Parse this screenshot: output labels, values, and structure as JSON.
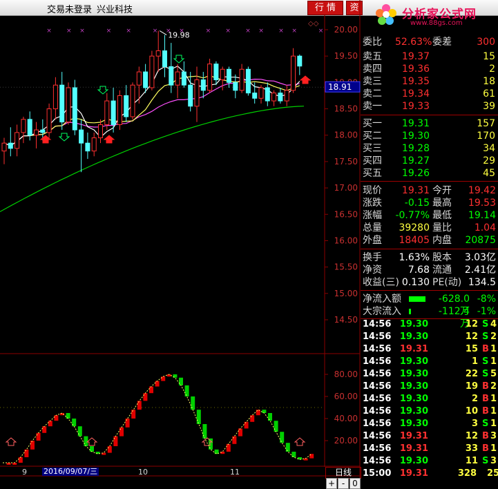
{
  "topbar": {
    "login_status": "交易未登录",
    "stock_name": "兴业科技",
    "btn_quote": "行 情",
    "btn_trade": "资"
  },
  "logo": {
    "title": "分析家公式网",
    "url": "www.88gs.com"
  },
  "chart": {
    "price_axis": [
      "20.00",
      "19.50",
      "19.00",
      "18.50",
      "18.00",
      "17.50",
      "17.00",
      "16.50",
      "16.00",
      "15.50",
      "15.00",
      "14.50"
    ],
    "current_price_tag": "18.91",
    "high_label": "19.98",
    "indicator_axis": [
      "80.00",
      "60.00",
      "40.00",
      "20.00"
    ],
    "date_ticks": [
      "9",
      "10",
      "11"
    ],
    "selected_date": "2016/09/07/三",
    "period": "日线",
    "colors": {
      "up": "#ff3030",
      "down": "#54ffff",
      "ma5": "#ffffff",
      "ma10": "#ffff60",
      "ma20": "#ff50ff",
      "ma60": "#00d000",
      "grid": "#8b0000"
    }
  },
  "chart_data": {
    "type": "line",
    "title": "",
    "price_ylim": [
      14.5,
      20.0
    ],
    "candles": [
      {
        "o": 17.7,
        "h": 17.95,
        "l": 17.45,
        "c": 17.85
      },
      {
        "o": 17.85,
        "h": 18.15,
        "l": 17.6,
        "c": 17.75
      },
      {
        "o": 17.75,
        "h": 18.2,
        "l": 17.6,
        "c": 18.05
      },
      {
        "o": 18.05,
        "h": 18.35,
        "l": 17.85,
        "c": 18.3
      },
      {
        "o": 18.3,
        "h": 18.45,
        "l": 17.9,
        "c": 18.0
      },
      {
        "o": 18.0,
        "h": 18.25,
        "l": 17.75,
        "c": 18.1
      },
      {
        "o": 18.1,
        "h": 18.3,
        "l": 17.9,
        "c": 18.05
      },
      {
        "o": 18.05,
        "h": 18.6,
        "l": 17.95,
        "c": 18.5
      },
      {
        "o": 18.5,
        "h": 19.1,
        "l": 18.3,
        "c": 18.95
      },
      {
        "o": 18.95,
        "h": 19.2,
        "l": 18.1,
        "c": 18.25
      },
      {
        "o": 18.25,
        "h": 19.0,
        "l": 18.2,
        "c": 18.9
      },
      {
        "o": 18.9,
        "h": 19.05,
        "l": 18.0,
        "c": 18.1
      },
      {
        "o": 18.1,
        "h": 18.3,
        "l": 17.3,
        "c": 17.85
      },
      {
        "o": 17.85,
        "h": 18.05,
        "l": 17.55,
        "c": 17.7
      },
      {
        "o": 17.7,
        "h": 18.05,
        "l": 17.6,
        "c": 17.95
      },
      {
        "o": 17.95,
        "h": 18.3,
        "l": 17.85,
        "c": 18.2
      },
      {
        "o": 18.2,
        "h": 18.8,
        "l": 18.1,
        "c": 18.65
      },
      {
        "o": 18.65,
        "h": 18.9,
        "l": 18.05,
        "c": 18.2
      },
      {
        "o": 18.2,
        "h": 18.85,
        "l": 18.1,
        "c": 18.75
      },
      {
        "o": 18.75,
        "h": 18.95,
        "l": 18.25,
        "c": 18.35
      },
      {
        "o": 18.35,
        "h": 19.0,
        "l": 18.3,
        "c": 18.95
      },
      {
        "o": 18.95,
        "h": 19.3,
        "l": 18.6,
        "c": 19.2
      },
      {
        "o": 19.2,
        "h": 19.35,
        "l": 18.8,
        "c": 18.9
      },
      {
        "o": 18.9,
        "h": 19.6,
        "l": 18.85,
        "c": 19.5
      },
      {
        "o": 19.5,
        "h": 19.98,
        "l": 19.2,
        "c": 19.6
      },
      {
        "o": 19.6,
        "h": 19.9,
        "l": 19.1,
        "c": 19.3
      },
      {
        "o": 19.3,
        "h": 19.75,
        "l": 18.8,
        "c": 18.95
      },
      {
        "o": 18.95,
        "h": 19.35,
        "l": 18.7,
        "c": 19.2
      },
      {
        "o": 19.2,
        "h": 19.4,
        "l": 18.9,
        "c": 18.95
      },
      {
        "o": 18.95,
        "h": 19.2,
        "l": 18.45,
        "c": 18.55
      },
      {
        "o": 18.55,
        "h": 19.3,
        "l": 18.25,
        "c": 19.05
      },
      {
        "o": 19.05,
        "h": 19.2,
        "l": 18.7,
        "c": 18.85
      },
      {
        "o": 18.85,
        "h": 19.45,
        "l": 18.8,
        "c": 19.35
      },
      {
        "o": 19.35,
        "h": 19.4,
        "l": 18.95,
        "c": 19.05
      },
      {
        "o": 19.05,
        "h": 19.3,
        "l": 18.85,
        "c": 19.25
      },
      {
        "o": 19.25,
        "h": 19.3,
        "l": 18.9,
        "c": 19.0
      },
      {
        "o": 19.0,
        "h": 19.15,
        "l": 18.7,
        "c": 18.85
      },
      {
        "o": 18.85,
        "h": 19.35,
        "l": 18.8,
        "c": 19.25
      },
      {
        "o": 19.25,
        "h": 19.3,
        "l": 18.75,
        "c": 18.8
      },
      {
        "o": 18.8,
        "h": 19.0,
        "l": 18.6,
        "c": 18.7
      },
      {
        "o": 18.7,
        "h": 18.95,
        "l": 18.6,
        "c": 18.9
      },
      {
        "o": 18.9,
        "h": 19.0,
        "l": 18.55,
        "c": 18.65
      },
      {
        "o": 18.65,
        "h": 18.85,
        "l": 18.55,
        "c": 18.8
      },
      {
        "o": 18.8,
        "h": 18.9,
        "l": 18.6,
        "c": 18.65
      },
      {
        "o": 18.65,
        "h": 18.95,
        "l": 18.55,
        "c": 18.85
      },
      {
        "o": 18.85,
        "h": 19.65,
        "l": 18.8,
        "c": 19.5
      },
      {
        "o": 19.5,
        "h": 19.53,
        "l": 19.14,
        "c": 19.31
      }
    ],
    "ma60_start_end": [
      16.55,
      18.55
    ],
    "indicator_ylim": [
      0,
      100
    ],
    "indicator": [
      0,
      0,
      0,
      5,
      12,
      20,
      27,
      33,
      38,
      43,
      45,
      40,
      33,
      24,
      15,
      10,
      8,
      9,
      15,
      24,
      32,
      40,
      48,
      56,
      63,
      69,
      74,
      78,
      80,
      77,
      70,
      60,
      48,
      35,
      22,
      12,
      8,
      10,
      17,
      24,
      31,
      37,
      43,
      48,
      45,
      38,
      28,
      18,
      10,
      5,
      3,
      4,
      8
    ]
  },
  "quote": {
    "ratio_label": "委比",
    "ratio": "52.63%",
    "diff_label": "委差",
    "diff": "300",
    "asks": [
      {
        "l": "卖五",
        "p": "19.37",
        "v": "15"
      },
      {
        "l": "卖四",
        "p": "19.36",
        "v": "2"
      },
      {
        "l": "卖三",
        "p": "19.35",
        "v": "18"
      },
      {
        "l": "卖二",
        "p": "19.34",
        "v": "61"
      },
      {
        "l": "卖一",
        "p": "19.33",
        "v": "39"
      }
    ],
    "bids": [
      {
        "l": "买一",
        "p": "19.31",
        "v": "157"
      },
      {
        "l": "买二",
        "p": "19.30",
        "v": "170"
      },
      {
        "l": "买三",
        "p": "19.28",
        "v": "34"
      },
      {
        "l": "买四",
        "p": "19.27",
        "v": "29"
      },
      {
        "l": "买五",
        "p": "19.26",
        "v": "45"
      }
    ],
    "stats": [
      {
        "l1": "现价",
        "v1": "19.31",
        "c1": "#ff3030",
        "l2": "今开",
        "v2": "19.42",
        "c2": "#ff3030"
      },
      {
        "l1": "涨跌",
        "v1": "-0.15",
        "c1": "#00ff00",
        "l2": "最高",
        "v2": "19.53",
        "c2": "#ff3030"
      },
      {
        "l1": "涨幅",
        "v1": "-0.77%",
        "c1": "#00ff00",
        "l2": "最低",
        "v2": "19.14",
        "c2": "#00ff00"
      },
      {
        "l1": "总量",
        "v1": "39280",
        "c1": "#ffff40",
        "l2": "量比",
        "v2": "1.04",
        "c2": "#ff3030"
      },
      {
        "l1": "外盘",
        "v1": "18405",
        "c1": "#ff3030",
        "l2": "内盘",
        "v2": "20875",
        "c2": "#00ff00"
      }
    ],
    "fin": [
      {
        "l1": "换手",
        "v1": "1.63%",
        "l2": "股本",
        "v2": "3.03亿"
      },
      {
        "l1": "净资",
        "v1": "7.68",
        "l2": "流通",
        "v2": "2.41亿"
      },
      {
        "l1": "收益(三)",
        "v1": "0.130",
        "l2": "PE(动)",
        "v2": "134.5"
      }
    ],
    "flow": [
      {
        "l": "净流入额",
        "v": "-628.0万",
        "p": "-8%"
      },
      {
        "l": "大宗流入",
        "v": "-112.4万",
        "p": "-1%"
      }
    ]
  },
  "ticks": [
    {
      "t": "14:56",
      "p": "19.30",
      "v": "12",
      "s": "S",
      "n": "4"
    },
    {
      "t": "14:56",
      "p": "19.30",
      "v": "12",
      "s": "S",
      "n": "2"
    },
    {
      "t": "14:56",
      "p": "19.31",
      "v": "15",
      "s": "B",
      "n": "1"
    },
    {
      "t": "14:56",
      "p": "19.30",
      "v": "1",
      "s": "S",
      "n": "1"
    },
    {
      "t": "14:56",
      "p": "19.30",
      "v": "22",
      "s": "S",
      "n": "5"
    },
    {
      "t": "14:56",
      "p": "19.30",
      "v": "19",
      "s": "B",
      "n": "2"
    },
    {
      "t": "14:56",
      "p": "19.30",
      "v": "2",
      "s": "B",
      "n": "1"
    },
    {
      "t": "14:56",
      "p": "19.30",
      "v": "10",
      "s": "B",
      "n": "1"
    },
    {
      "t": "14:56",
      "p": "19.30",
      "v": "3",
      "s": "S",
      "n": "1"
    },
    {
      "t": "14:56",
      "p": "19.31",
      "v": "12",
      "s": "B",
      "n": "3"
    },
    {
      "t": "14:56",
      "p": "19.31",
      "v": "33",
      "s": "B",
      "n": "1"
    },
    {
      "t": "14:56",
      "p": "19.30",
      "v": "11",
      "s": "S",
      "n": "3"
    },
    {
      "t": "15:00",
      "p": "19.31",
      "v": "328",
      "s": "",
      "n": "25"
    }
  ],
  "controls": {
    "plus": "+",
    "minus": "-",
    "zero": "0"
  }
}
